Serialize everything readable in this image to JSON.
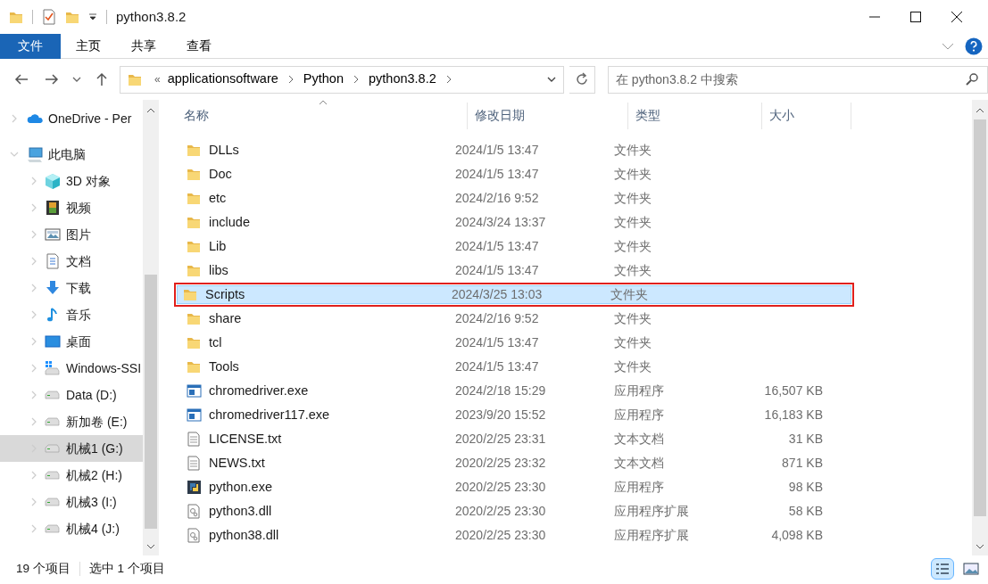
{
  "window": {
    "title": "python3.8.2"
  },
  "ribbon_tabs": [
    {
      "label": "文件",
      "selected": true
    },
    {
      "label": "主页",
      "selected": false
    },
    {
      "label": "共享",
      "selected": false
    },
    {
      "label": "查看",
      "selected": false
    }
  ],
  "address_bar": {
    "overflow": "«",
    "segments": [
      "applicationsoftware",
      "Python",
      "python3.8.2"
    ]
  },
  "search": {
    "placeholder": "在 python3.8.2 中搜索"
  },
  "sidebar": {
    "items": [
      {
        "label": "OneDrive - Per",
        "kind": "cloud",
        "expanded": false,
        "selected": false
      },
      {
        "label": "此电脑",
        "kind": "pc",
        "expanded": true,
        "selected": false,
        "children": [
          {
            "label": "3D 对象",
            "kind": "cube",
            "expanded": false,
            "selected": false
          },
          {
            "label": "视频",
            "kind": "video",
            "expanded": false,
            "selected": false
          },
          {
            "label": "图片",
            "kind": "image",
            "expanded": false,
            "selected": false
          },
          {
            "label": "文档",
            "kind": "doc",
            "expanded": false,
            "selected": false
          },
          {
            "label": "下载",
            "kind": "download",
            "expanded": false,
            "selected": false
          },
          {
            "label": "音乐",
            "kind": "music",
            "expanded": false,
            "selected": false
          },
          {
            "label": "桌面",
            "kind": "desktop",
            "expanded": false,
            "selected": false
          },
          {
            "label": "Windows-SSI",
            "kind": "windrive",
            "expanded": false,
            "selected": false
          },
          {
            "label": "Data (D:)",
            "kind": "drive",
            "expanded": false,
            "selected": false
          },
          {
            "label": "新加卷 (E:)",
            "kind": "drive",
            "expanded": false,
            "selected": false
          },
          {
            "label": "机械1 (G:)",
            "kind": "drive",
            "expanded": false,
            "selected": true
          },
          {
            "label": "机械2 (H:)",
            "kind": "drive",
            "expanded": false,
            "selected": false
          },
          {
            "label": "机械3 (I:)",
            "kind": "drive",
            "expanded": false,
            "selected": false
          },
          {
            "label": "机械4 (J:)",
            "kind": "drive",
            "expanded": false,
            "selected": false
          }
        ]
      }
    ]
  },
  "table": {
    "columns": [
      "名称",
      "修改日期",
      "类型",
      "大小"
    ],
    "rows": [
      {
        "kind": "folder",
        "name": "DLLs",
        "modified": "2024/1/5 13:47",
        "type": "文件夹",
        "selected": false
      },
      {
        "kind": "folder",
        "name": "Doc",
        "modified": "2024/1/5 13:47",
        "type": "文件夹",
        "selected": false
      },
      {
        "kind": "folder",
        "name": "etc",
        "modified": "2024/2/16 9:52",
        "type": "文件夹",
        "selected": false
      },
      {
        "kind": "folder",
        "name": "include",
        "modified": "2024/3/24 13:37",
        "type": "文件夹",
        "selected": false
      },
      {
        "kind": "folder",
        "name": "Lib",
        "modified": "2024/1/5 13:47",
        "type": "文件夹",
        "selected": false
      },
      {
        "kind": "folder",
        "name": "libs",
        "modified": "2024/1/5 13:47",
        "type": "文件夹",
        "selected": false
      },
      {
        "kind": "folder",
        "name": "Scripts",
        "modified": "2024/3/25 13:03",
        "type": "文件夹",
        "selected": true,
        "highlighted": true
      },
      {
        "kind": "folder",
        "name": "share",
        "modified": "2024/2/16 9:52",
        "type": "文件夹",
        "selected": false
      },
      {
        "kind": "folder",
        "name": "tcl",
        "modified": "2024/1/5 13:47",
        "type": "文件夹",
        "selected": false
      },
      {
        "kind": "folder",
        "name": "Tools",
        "modified": "2024/1/5 13:47",
        "type": "文件夹",
        "selected": false
      },
      {
        "kind": "exe",
        "name": "chromedriver.exe",
        "modified": "2024/2/18 15:29",
        "type": "应用程序",
        "size": "16,507 KB",
        "selected": false
      },
      {
        "kind": "exe",
        "name": "chromedriver117.exe",
        "modified": "2023/9/20 15:52",
        "type": "应用程序",
        "size": "16,183 KB",
        "selected": false
      },
      {
        "kind": "txt",
        "name": "LICENSE.txt",
        "modified": "2020/2/25 23:31",
        "type": "文本文档",
        "size": "31 KB",
        "selected": false
      },
      {
        "kind": "txt",
        "name": "NEWS.txt",
        "modified": "2020/2/25 23:32",
        "type": "文本文档",
        "size": "871 KB",
        "selected": false
      },
      {
        "kind": "python",
        "name": "python.exe",
        "modified": "2020/2/25 23:30",
        "type": "应用程序",
        "size": "98 KB",
        "selected": false
      },
      {
        "kind": "dll",
        "name": "python3.dll",
        "modified": "2020/2/25 23:30",
        "type": "应用程序扩展",
        "size": "58 KB",
        "selected": false
      },
      {
        "kind": "dll",
        "name": "python38.dll",
        "modified": "2020/2/25 23:30",
        "type": "应用程序扩展",
        "size": "4,098 KB",
        "selected": false
      }
    ]
  },
  "status_bar": {
    "item_count": "19 个项目",
    "selection": "选中 1 个项目"
  }
}
